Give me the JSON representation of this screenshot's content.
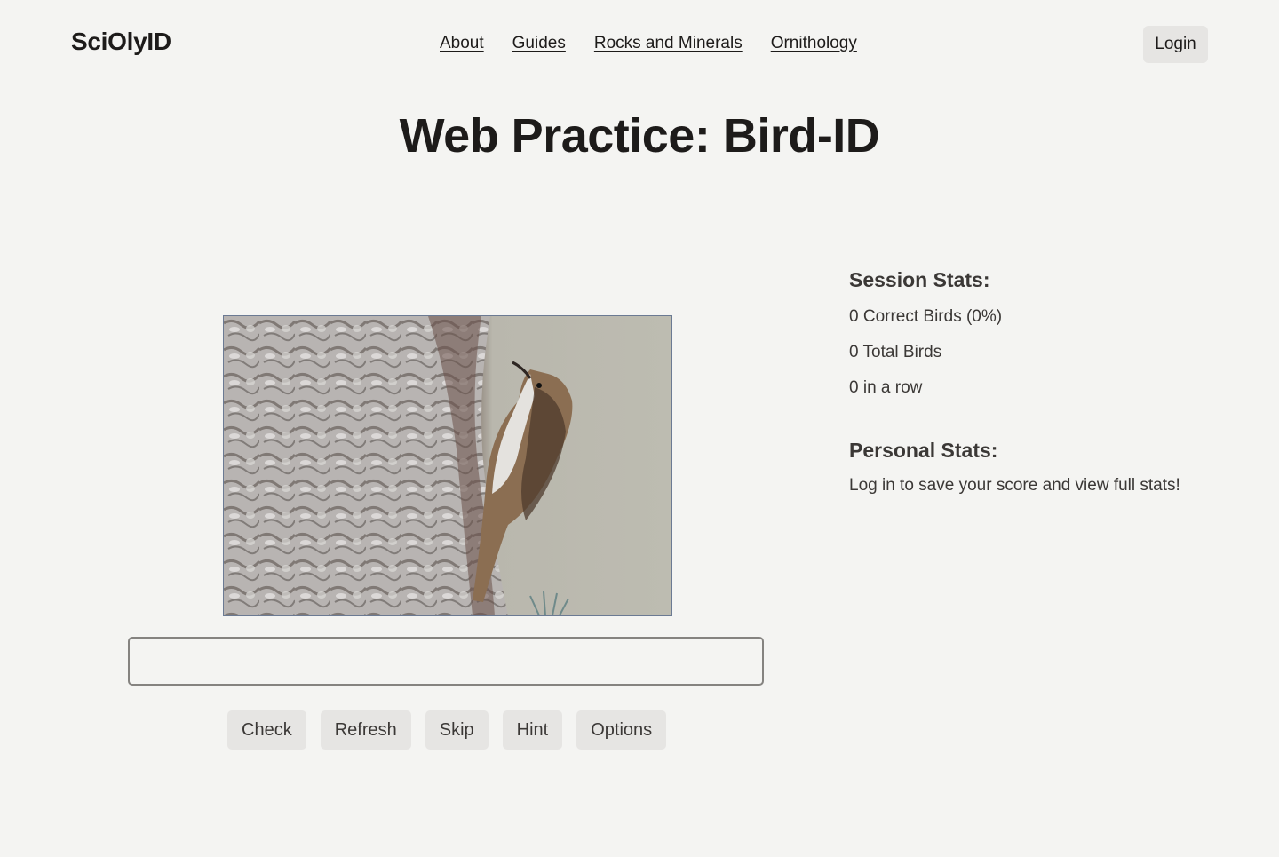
{
  "header": {
    "logo": "SciOlyID",
    "nav": [
      {
        "label": "About"
      },
      {
        "label": "Guides"
      },
      {
        "label": "Rocks and Minerals"
      },
      {
        "label": "Ornithology"
      }
    ],
    "login_label": "Login"
  },
  "main": {
    "title": "Web Practice: Bird-ID",
    "image": {
      "alt": "Bird photo: brown-streaked bird climbing a tree trunk"
    },
    "answer_input": {
      "value": "",
      "placeholder": ""
    },
    "buttons": [
      {
        "label": "Check"
      },
      {
        "label": "Refresh"
      },
      {
        "label": "Skip"
      },
      {
        "label": "Hint"
      },
      {
        "label": "Options"
      }
    ]
  },
  "stats": {
    "session_title": "Session Stats:",
    "correct": "0 Correct Birds (0%)",
    "total": "0 Total Birds",
    "streak": "0 in a row",
    "personal_title": "Personal Stats:",
    "personal_message": "Log in to save your score and view full stats!"
  },
  "colors": {
    "background": "#f4f4f2",
    "text": "#1d1b1a",
    "button_bg": "#e6e5e3",
    "image_border": "#6b7a93"
  }
}
